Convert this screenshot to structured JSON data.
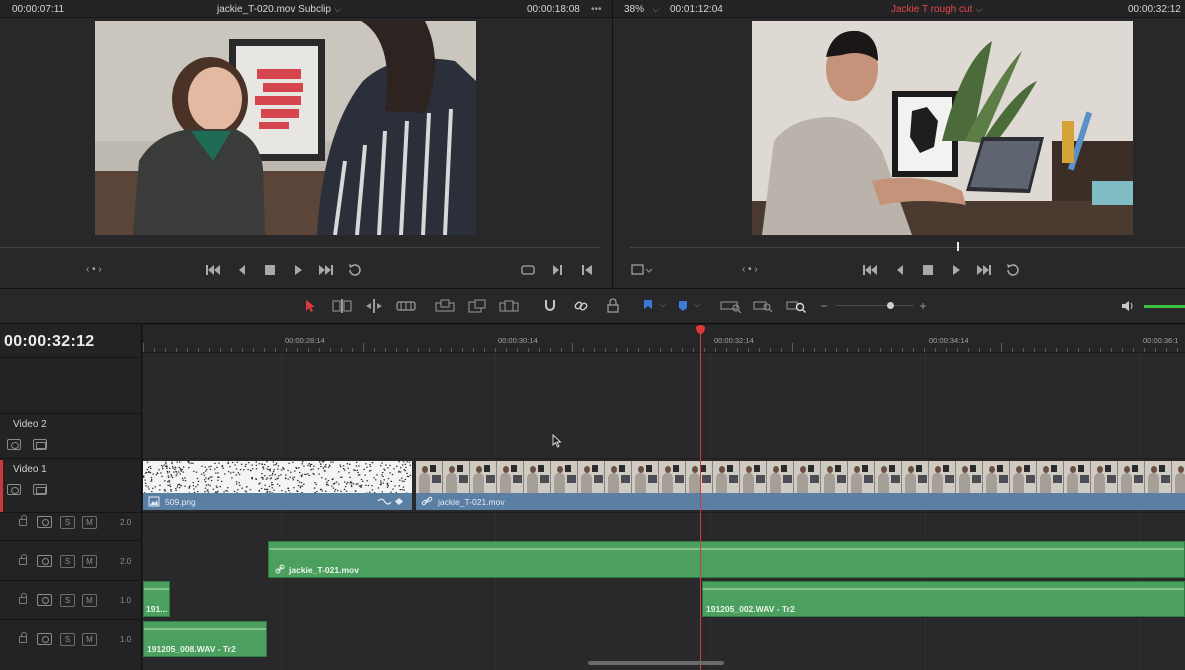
{
  "source_viewer": {
    "timecode_left": "00:00:07:11",
    "title": "jackie_T-020.mov Subclip",
    "duration": "00:00:18:08",
    "more": "•••"
  },
  "timeline_viewer": {
    "zoom": "38%",
    "duration": "00:01:12:04",
    "title": "Jackie T rough cut",
    "timecode_right": "00:00:32:12"
  },
  "viewer_controls": {
    "jog_left": "‹ • ›",
    "jog_right": "‹ • ›"
  },
  "timeline": {
    "timecode": "00:00:32:12",
    "ruler_labels": [
      "00:00:28:14",
      "00:00:30:14",
      "00:00:32:14",
      "00:00:34:14",
      "00:00:36:1"
    ],
    "tracks": {
      "video2": {
        "name": "Video 2"
      },
      "video1": {
        "name": "Video 1"
      },
      "audio": [
        {
          "level": "2.0",
          "solo": "S",
          "mute": "M"
        },
        {
          "level": "2.0",
          "solo": "S",
          "mute": "M"
        },
        {
          "level": "1.0",
          "solo": "S",
          "mute": "M"
        },
        {
          "level": "1.0",
          "solo": "S",
          "mute": "M"
        }
      ]
    },
    "clips": {
      "v1_png": "509.png",
      "v1_mov": "jackie_T-021.mov",
      "a2_mov": "jackie_T-021.mov",
      "a3_short": "191...",
      "a3_wav": "191205_002.WAV - Tr2",
      "a4_wav": "191205_008.WAV - Tr2"
    }
  },
  "colors": {
    "accent_red": "#e0393c",
    "video_clip": "#5b7ea3",
    "audio_clip": "#4b9f5f",
    "flag_blue": "#3e7bd6",
    "volume_green": "#3fc43f"
  }
}
